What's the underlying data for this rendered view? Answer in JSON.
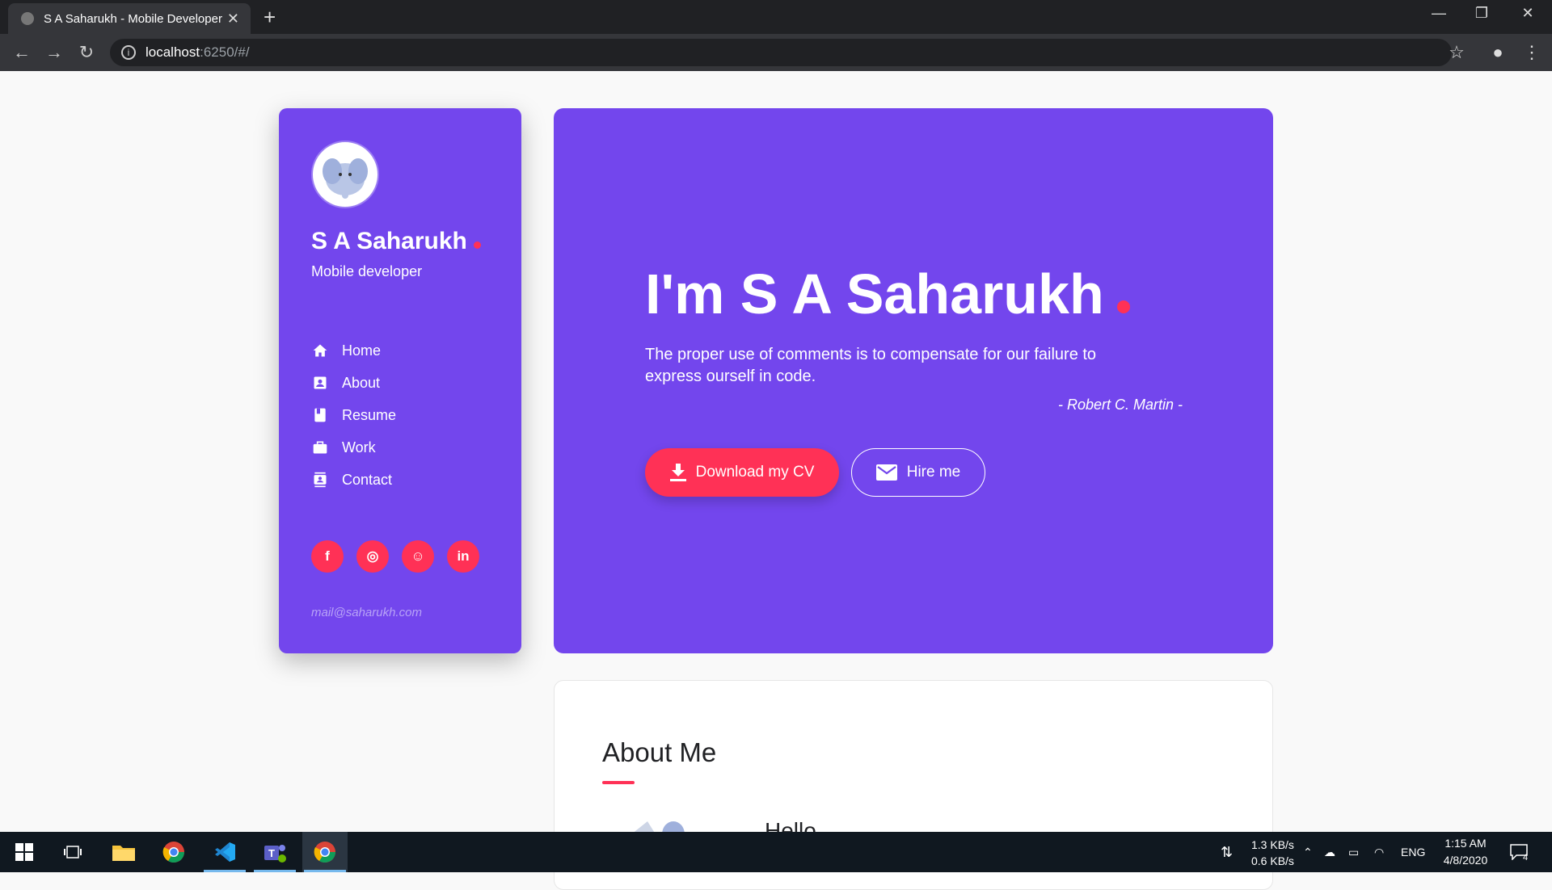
{
  "browser": {
    "tab_title": "S A Saharukh - Mobile Developer",
    "url_host": "localhost",
    "url_path": ":6250/#/"
  },
  "sidebar": {
    "name": "S A Saharukh",
    "role": "Mobile developer",
    "nav": [
      {
        "label": "Home",
        "icon": "home-icon"
      },
      {
        "label": "About",
        "icon": "account-box-icon"
      },
      {
        "label": "Resume",
        "icon": "book-icon"
      },
      {
        "label": "Work",
        "icon": "briefcase-icon"
      },
      {
        "label": "Contact",
        "icon": "contacts-icon"
      }
    ],
    "social": [
      {
        "label": "f",
        "icon": "facebook-icon"
      },
      {
        "label": "◎",
        "icon": "instagram-icon"
      },
      {
        "label": "☺",
        "icon": "github-icon"
      },
      {
        "label": "in",
        "icon": "linkedin-icon"
      }
    ],
    "email": "mail@saharukh.com"
  },
  "hero": {
    "title": "I'm S A Saharukh",
    "quote": "The proper use of comments is to compensate for our failure to express ourself in code.",
    "author": "- Robert C. Martin -",
    "download_label": "Download my CV",
    "hire_label": "Hire me"
  },
  "about": {
    "title": "About Me",
    "greeting": "Hello"
  },
  "taskbar": {
    "net_down": "1.3 KB/s",
    "net_up": "0.6 KB/s",
    "lang": "ENG",
    "time": "1:15 AM",
    "date": "4/8/2020",
    "notifications": "4"
  },
  "colors": {
    "accent": "#7346ed",
    "highlight": "#ff3156"
  }
}
